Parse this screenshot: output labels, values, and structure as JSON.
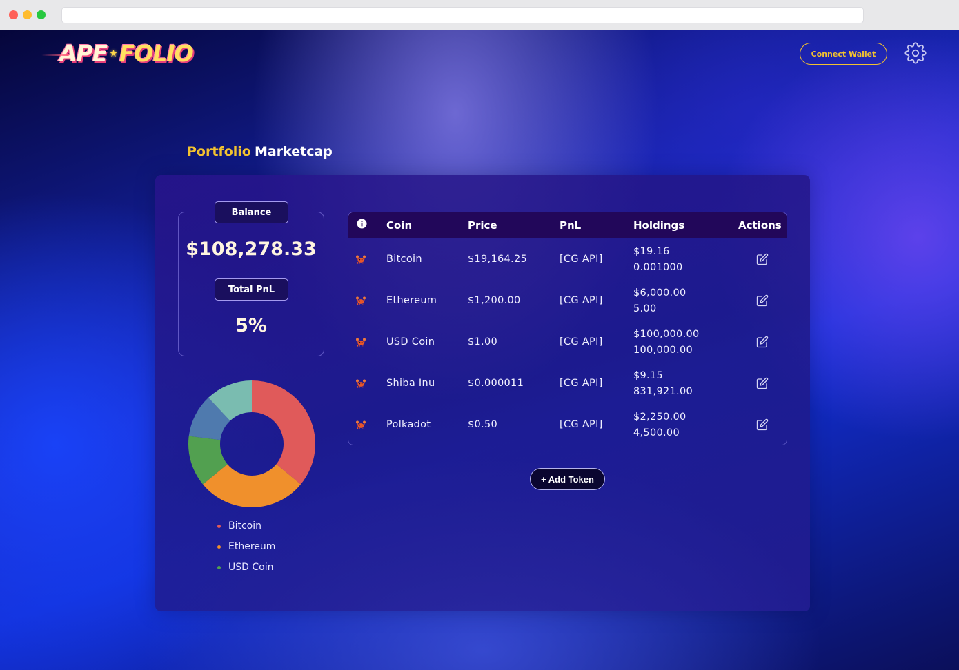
{
  "logo": {
    "part1": "APE",
    "star": "★",
    "part2": "FOLIO"
  },
  "header": {
    "connect_wallet_label": "Connect Wallet"
  },
  "tabs": [
    {
      "label": "Portfolio",
      "active": true
    },
    {
      "label": "Marketcap",
      "active": false
    }
  ],
  "summary": {
    "balance_label": "Balance",
    "balance_value": "$108,278.33",
    "pnl_label": "Total PnL",
    "pnl_value": "5%"
  },
  "table": {
    "columns": {
      "coin": "Coin",
      "price": "Price",
      "pnl": "PnL",
      "holdings": "Holdings",
      "actions": "Actions"
    },
    "rows": [
      {
        "coin": "Bitcoin",
        "price": "$19,164.25",
        "pnl": "[CG API]",
        "holdings_value": "$19.16",
        "holdings_amount": "0.001000"
      },
      {
        "coin": "Ethereum",
        "price": "$1,200.00",
        "pnl": "[CG API]",
        "holdings_value": "$6,000.00",
        "holdings_amount": "5.00"
      },
      {
        "coin": "USD Coin",
        "price": "$1.00",
        "pnl": "[CG API]",
        "holdings_value": "$100,000.00",
        "holdings_amount": "100,000.00"
      },
      {
        "coin": "Shiba Inu",
        "price": "$0.000011",
        "pnl": "[CG API]",
        "holdings_value": "$9.15",
        "holdings_amount": "831,921.00"
      },
      {
        "coin": "Polkadot",
        "price": "$0.50",
        "pnl": "[CG API]",
        "holdings_value": "$2,250.00",
        "holdings_amount": "4,500.00"
      }
    ]
  },
  "add_token_label": "+ Add Token",
  "chart_data": {
    "type": "pie",
    "slices": [
      {
        "label": "Bitcoin",
        "value": 36,
        "color": "#e05a5a"
      },
      {
        "label": "Ethereum",
        "value": 28,
        "color": "#f0902c"
      },
      {
        "label": "USD Coin",
        "value": 13,
        "color": "#52a050"
      },
      {
        "label": "",
        "value": 11,
        "color": "#4f7aae"
      },
      {
        "label": "",
        "value": 12,
        "color": "#7abcb0"
      }
    ],
    "legend": [
      {
        "label": "Bitcoin",
        "color": "#e05a5a"
      },
      {
        "label": "Ethereum",
        "color": "#f0902c"
      },
      {
        "label": "USD Coin",
        "color": "#52a050"
      }
    ]
  },
  "colors": {
    "accent": "#f2c230",
    "panel": "#22075a"
  },
  "icons": {
    "row_icon": "crab-icon",
    "action_icon": "edit-icon",
    "header_icon": "info-icon",
    "settings": "gear-icon"
  }
}
